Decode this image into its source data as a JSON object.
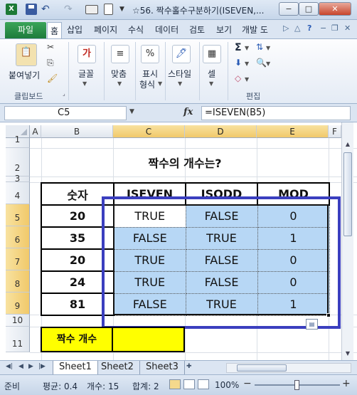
{
  "window": {
    "title": "☆56. 짝수홀수구분하기(ISEVEN,...",
    "app_icon": "X",
    "minimize": "−",
    "maximize": "□",
    "close": "✕"
  },
  "ribbon_tabs": {
    "file": "파일",
    "items": [
      "홈",
      "삽입",
      "페이지",
      "수식",
      "데이터",
      "검토",
      "보기",
      "개발 도"
    ]
  },
  "ribbon": {
    "paste": "붙여넣기",
    "clipboard_group": "클립보드",
    "font": "글꼴",
    "alignment": "맞춤",
    "number_format_line1": "표시",
    "number_format_line2": "형식",
    "styles": "스타일",
    "cells": "셀",
    "editing_group": "편집",
    "font_icon": "가",
    "number_icon": "%"
  },
  "formula_bar": {
    "name_box": "C5",
    "fx": "fx",
    "formula": "=ISEVEN(B5)"
  },
  "columns": [
    "A",
    "B",
    "C",
    "D",
    "E",
    "F"
  ],
  "rows": [
    "1",
    "2",
    "3",
    "4",
    "5",
    "6",
    "7",
    "8",
    "9",
    "10",
    "11"
  ],
  "sheet": {
    "title": "짝수의  개수는?",
    "headers": [
      "숫자",
      "ISEVEN",
      "ISODD",
      "MOD"
    ],
    "data": [
      [
        "20",
        "TRUE",
        "FALSE",
        "0"
      ],
      [
        "35",
        "FALSE",
        "TRUE",
        "1"
      ],
      [
        "20",
        "TRUE",
        "FALSE",
        "0"
      ],
      [
        "24",
        "TRUE",
        "FALSE",
        "0"
      ],
      [
        "81",
        "FALSE",
        "TRUE",
        "1"
      ]
    ],
    "count_label": "짝수  개수",
    "count_value": ""
  },
  "sheet_tabs": [
    "Sheet1",
    "Sheet2",
    "Sheet3"
  ],
  "status": {
    "mode": "준비",
    "average": "평균: 0.4",
    "count": "개수: 15",
    "sum": "합계: 2",
    "zoom": "100%"
  },
  "colors": {
    "selection_fill": "#b7d7f5",
    "annotation": "#3b3fbf",
    "highlight": "#ffff00",
    "file_tab": "#1e7b3b"
  }
}
